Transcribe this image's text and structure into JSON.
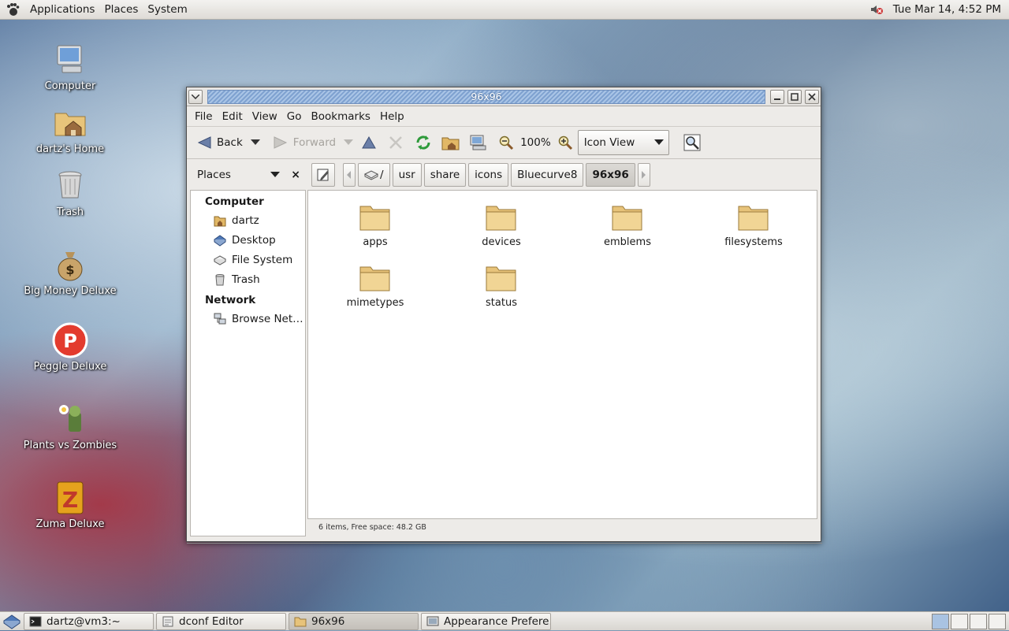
{
  "top_panel": {
    "menus": [
      "Applications",
      "Places",
      "System"
    ],
    "clock": "Tue Mar 14,  4:52 PM"
  },
  "desktop": {
    "icons": [
      {
        "label": "Computer"
      },
      {
        "label": "dartz's Home"
      },
      {
        "label": "Trash"
      },
      {
        "label": "Big Money Deluxe"
      },
      {
        "label": "Peggle Deluxe"
      },
      {
        "label": "Plants vs Zombies"
      },
      {
        "label": "Zuma Deluxe"
      }
    ]
  },
  "window": {
    "title": "96x96",
    "menu": [
      "File",
      "Edit",
      "View",
      "Go",
      "Bookmarks",
      "Help"
    ],
    "toolbar": {
      "back": "Back",
      "forward": "Forward",
      "zoom": "100%",
      "view_mode": "Icon View"
    },
    "sidebar": {
      "header": "Places",
      "close": "×",
      "sections": [
        {
          "title": "Computer",
          "items": [
            "dartz",
            "Desktop",
            "File System",
            "Trash"
          ]
        },
        {
          "title": "Network",
          "items": [
            "Browse Net…"
          ]
        }
      ]
    },
    "path": {
      "root": "/",
      "crumbs": [
        "usr",
        "share",
        "icons",
        "Bluecurve8",
        "96x96"
      ]
    },
    "files": [
      "apps",
      "devices",
      "emblems",
      "filesystems",
      "mimetypes",
      "status"
    ],
    "status": "6 items, Free space: 48.2 GB"
  },
  "taskbar": {
    "tasks": [
      "dartz@vm3:~",
      "dconf Editor",
      "96x96",
      "Appearance Prefere…"
    ]
  }
}
